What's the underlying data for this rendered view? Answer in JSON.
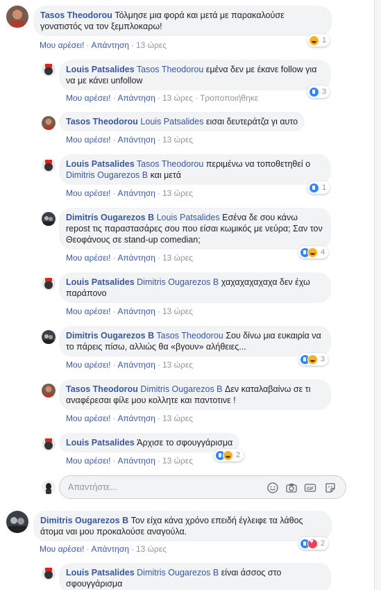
{
  "labels": {
    "like": "Μου αρέσει!",
    "reply": "Απάντηση",
    "sep": "·"
  },
  "comments": [
    {
      "author": "Tasos Theodorou",
      "mention": "",
      "text": "Τόλμησε μια φορά και μετά με παρακαλούσε γονατιστός να τον ξεμπλοκαρω!",
      "time": "13 ώρες",
      "edited": "",
      "reaction_count": "1",
      "avatar": "tasos"
    },
    {
      "author": "Louis Patsalides",
      "mention": "Tasos Theodorou",
      "text": "εμένα δεν με έκανε follow για να με κάνει unfollow",
      "time": "13 ώρες",
      "edited": "Τροποποιήθηκε",
      "reaction_count": "3",
      "avatar": "louis"
    },
    {
      "author": "Tasos Theodorou",
      "mention": "Louis Patsalides",
      "text": "εισαι δευτεράτζα γι αυτο",
      "time": "13 ώρες",
      "edited": "",
      "reaction_count": "",
      "avatar": "tasos"
    },
    {
      "author": "Louis Patsalides",
      "mention": "Tasos Theodorou",
      "text_before": "περιμένω να τοποθετηθεί ο",
      "mention2": "Dimitris Ougarezos B",
      "text": "και μετά",
      "time": "13 ώρες",
      "edited": "",
      "reaction_count": "1",
      "avatar": "louis"
    },
    {
      "author": "Dimitris Ougarezos B",
      "mention": "Louis Patsalides",
      "text": "Εσένα δε σου κάνω repost τις παραστασάρες σου που είσαι κωμικός με νεύρα; Σαν τον Θεοφάνους σε stand-up comedian;",
      "time": "13 ώρες",
      "edited": "",
      "reaction_count": "4",
      "avatar": "dimitris"
    },
    {
      "author": "Louis Patsalides",
      "mention": "Dimitris Ougarezos B",
      "text": "χαχαχαχαχαχα δεν έχω παράπονο",
      "time": "13 ώρες",
      "edited": "",
      "reaction_count": "",
      "avatar": "louis"
    },
    {
      "author": "Dimitris Ougarezos B",
      "mention": "Tasos Theodorou",
      "text": "Σου δίνω μια ευκαιρία να το πάρεις πίσω, αλλιώς θα «βγουν» αλήθειες...",
      "time": "13 ώρες",
      "edited": "",
      "reaction_count": "3",
      "avatar": "dimitris"
    },
    {
      "author": "Tasos Theodorou",
      "mention": "Dimitris Ougarezos B",
      "text": "Δεν καταλαβαίνω σε τι αναφέρεσαι φίλε μου κολλητε και παντοτινε !",
      "time": "13 ώρες",
      "edited": "",
      "reaction_count": "",
      "avatar": "tasos"
    },
    {
      "author": "Louis Patsalides",
      "mention": "",
      "text": "Άρχισε το σφουγγάρισμα",
      "time": "13 ώρες",
      "edited": "",
      "reaction_count": "2",
      "avatar": "louis"
    },
    {
      "author": "Dimitris Ougarezos B",
      "mention": "",
      "text": "Τον είχα κάνα χρόνο επειδή έγλειφε τα λάθος άτομα ναι μου προκαλούσε αναγούλα.",
      "time": "13 ώρες",
      "edited": "",
      "reaction_count": "2",
      "avatar": "dimitris"
    },
    {
      "author": "Louis Patsalides",
      "mention": "Dimitris Ougarezos B",
      "text": "είναι άσσος στο σφουγγάρισμα",
      "time": "",
      "edited": "",
      "reaction_count": "",
      "avatar": "louis"
    }
  ],
  "reply_box": {
    "placeholder": "Απαντήστε..."
  },
  "colors": {
    "link": "#385898",
    "bubble": "#f2f3f5",
    "like": "#2d88ff",
    "haha": "#f7b125",
    "love": "#f33e58"
  }
}
